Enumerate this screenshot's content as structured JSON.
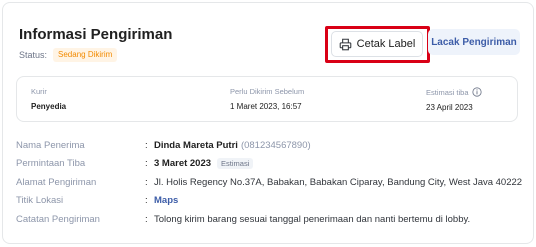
{
  "header": {
    "title": "Informasi Pengiriman",
    "status_label": "Status:",
    "status_badge": "Sedang Dikirim"
  },
  "actions": {
    "print_label": "Cetak Label",
    "track_label": "Lacak Pengiriman"
  },
  "summary": {
    "courier_label": "Kurir",
    "courier_value": "Penyedia",
    "ship_before_label": "Perlu Dikirim Sebelum",
    "ship_before_value": "1 Maret 2023, 16:57",
    "eta_label": "Estimasi tiba",
    "eta_value": "23 April 2023"
  },
  "details": {
    "recipient_label": "Nama Penerima",
    "recipient_name": "Dinda Mareta Putri",
    "recipient_phone": "(081234567890)",
    "request_label": "Permintaan Tiba",
    "request_value": "3 Maret 2023",
    "request_badge": "Estimasi",
    "address_label": "Alamat Pengiriman",
    "address_value": "Jl. Holis Regency No.37A, Babakan, Babakan Ciparay, Bandung City, West Java 40222",
    "location_label": "Titik Lokasi",
    "location_value": "Maps",
    "notes_label": "Catatan Pengiriman",
    "notes_value": "Tolong kirim barang sesuai tanggal penerimaan dan nanti bertemu di lobby.",
    "colon": ":"
  },
  "colors": {
    "accent_blue": "#3d5da8",
    "status_orange": "#f28a00",
    "highlight_red": "#d90016"
  },
  "icons": {
    "print": "printer-icon",
    "info": "info-circle-icon"
  }
}
